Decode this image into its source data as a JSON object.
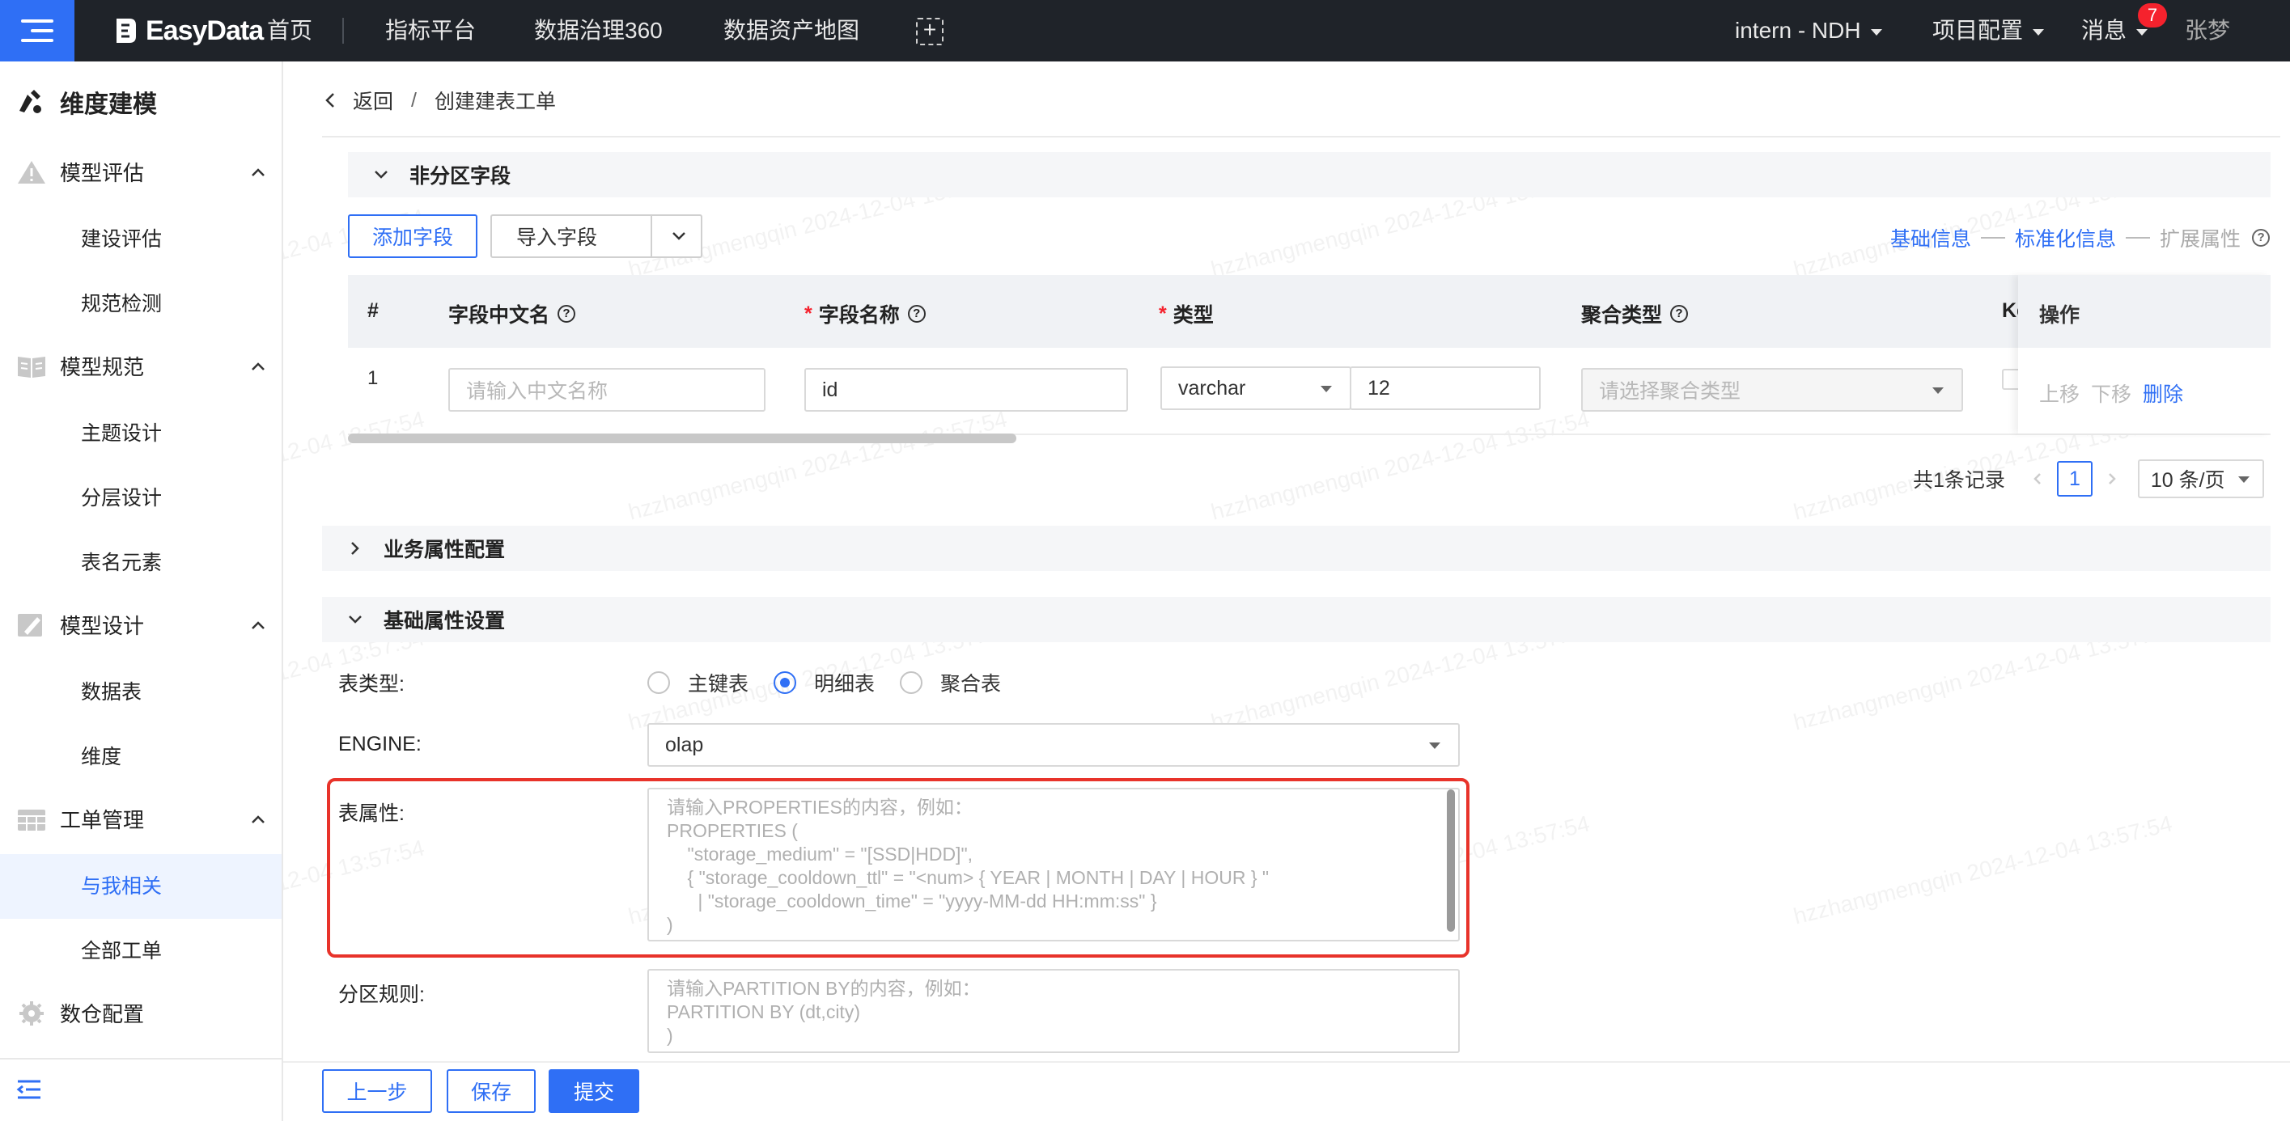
{
  "topbar": {
    "logo_text": "EasyData",
    "nav": [
      "首页",
      "指标平台",
      "数据治理360",
      "数据资产地图"
    ],
    "workspace": "intern - NDH",
    "project_config": "项目配置",
    "messages": "消息",
    "message_count": "7",
    "user": "张梦"
  },
  "sidebar": {
    "title": "维度建模",
    "groups": [
      {
        "label": "模型评估",
        "items": [
          "建设评估",
          "规范检测"
        ]
      },
      {
        "label": "模型规范",
        "items": [
          "主题设计",
          "分层设计",
          "表名元素"
        ]
      },
      {
        "label": "模型设计",
        "items": [
          "数据表",
          "维度"
        ]
      },
      {
        "label": "工单管理",
        "items": [
          "与我相关",
          "全部工单"
        ]
      }
    ],
    "bottom_item": "数仓配置"
  },
  "breadcrumb": {
    "back": "返回",
    "sep": "/",
    "current": "创建建表工单"
  },
  "non_partition": {
    "title": "非分区字段",
    "add_field": "添加字段",
    "import_field": "导入字段",
    "steps": [
      "基础信息",
      "标准化信息",
      "扩展属性"
    ],
    "columns": {
      "index": "#",
      "cn_name": "字段中文名",
      "name": "字段名称",
      "type": "类型",
      "agg": "聚合类型",
      "key": "Ke",
      "ops": "操作"
    },
    "rows": [
      {
        "index": "1",
        "cn_name_placeholder": "请输入中文名称",
        "name": "id",
        "type": "varchar",
        "length": "12",
        "agg_placeholder": "请选择聚合类型"
      }
    ],
    "row_ops": [
      "上移",
      "下移",
      "删除"
    ],
    "pager": {
      "total": "共1条记录",
      "page": "1",
      "size": "10 条/页"
    }
  },
  "business_section": {
    "title": "业务属性配置"
  },
  "basic_section": {
    "title": "基础属性设置",
    "table_type_label": "表类型:",
    "table_types": [
      "主键表",
      "明细表",
      "聚合表"
    ],
    "engine_label": "ENGINE:",
    "engine_value": "olap",
    "props_label": "表属性:",
    "props_placeholder": "请输入PROPERTIES的内容，例如：\nPROPERTIES (\n    \"storage_medium\" = \"[SSD|HDD]\",\n    { \"storage_cooldown_ttl\" = \"<num> { YEAR | MONTH | DAY | HOUR } \"\n      | \"storage_cooldown_time\" = \"yyyy-MM-dd HH:mm:ss\" }\n)",
    "partition_label": "分区规则:",
    "partition_placeholder": "请输入PARTITION BY的内容，例如：\nPARTITION BY (dt,city)\n)"
  },
  "footer": {
    "prev": "上一步",
    "save": "保存",
    "submit": "提交"
  },
  "watermark": "hzzhangmengqin 2024-12-04 13:57:54",
  "colors": {
    "primary": "#2f6ff5",
    "topbar": "#1f2329",
    "highlight": "#e8332a",
    "badge": "#f5222d"
  }
}
